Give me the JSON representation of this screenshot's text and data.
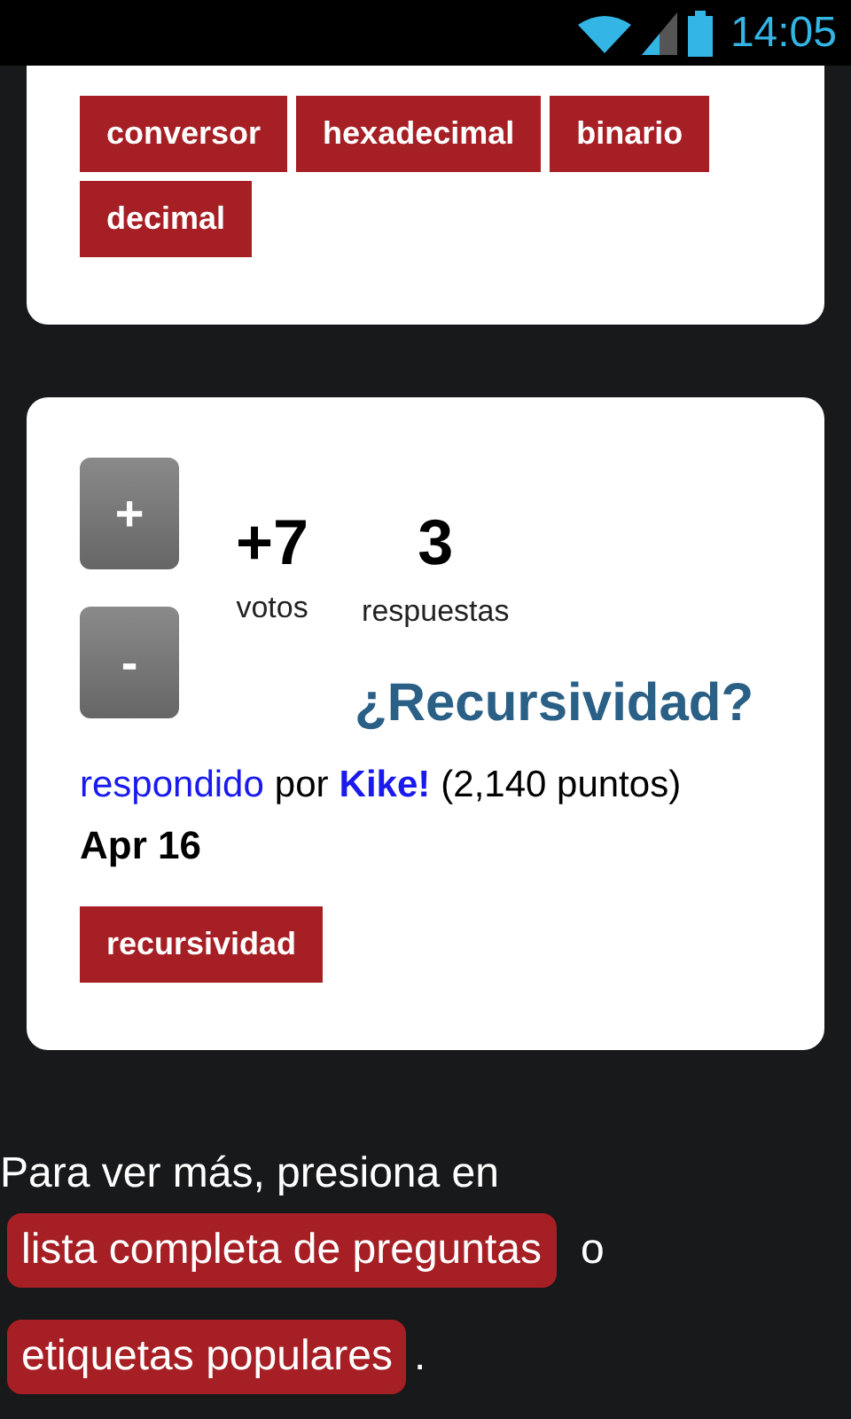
{
  "status_bar": {
    "time": "14:05"
  },
  "tag_card": {
    "tags": [
      "conversor",
      "hexadecimal",
      "binario",
      "decimal"
    ]
  },
  "question_card": {
    "vote_buttons": [
      "+",
      "-"
    ],
    "votes": "+7",
    "votes_label": "votos",
    "answers": "3",
    "answers_label": "respuestas",
    "title": "¿Recursividad?",
    "action": "respondido",
    "by": "por",
    "user": "Kike!",
    "points": "(2,140 puntos)",
    "date": "Apr 16",
    "tags": [
      "recursividad"
    ]
  },
  "footer": {
    "intro": "Para ver más, presiona en",
    "link_1": "lista completa de preguntas",
    "separator": "o",
    "link_2": "etiquetas populares",
    "end": "."
  }
}
